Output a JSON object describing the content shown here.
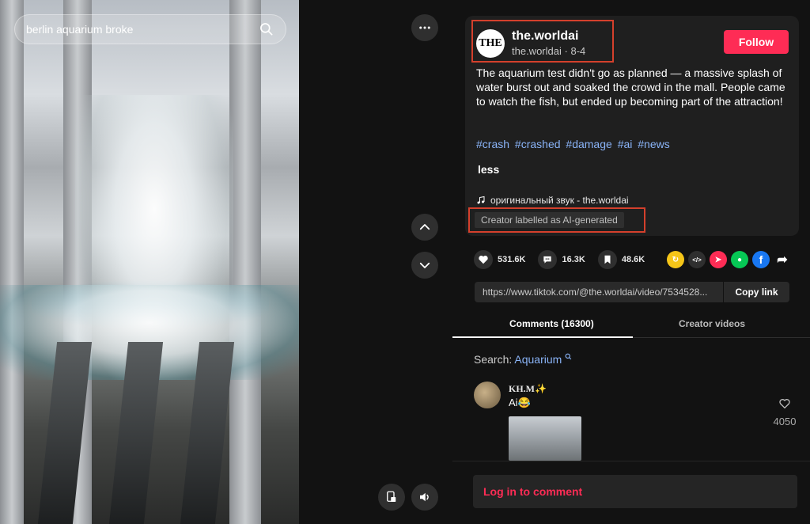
{
  "search": {
    "value": "berlin aquarium broke"
  },
  "post": {
    "username": "the.worldai",
    "handle": "the.worldai",
    "separator": "·",
    "date": "8-4",
    "avatar_text": "THE",
    "follow_label": "Follow",
    "description": "The aquarium test didn't go as planned — a massive splash of water burst out and soaked the crowd in the mall. People came to watch the fish, but ended up becoming part of the attraction!",
    "hashtags": [
      "#crash",
      "#crashed",
      "#damage",
      "#ai",
      "#news"
    ],
    "less_label": "less",
    "sound": "оригинальный звук - the.worldai",
    "ai_label": "Creator labelled as AI-generated"
  },
  "stats": {
    "likes": "531.6K",
    "comments": "16.3K",
    "saves": "48.6K"
  },
  "share_icons": [
    {
      "name": "repost-icon",
      "color": "#f5c518",
      "glyph": "↻"
    },
    {
      "name": "embed-icon",
      "color": "#2f2f2f",
      "glyph": "</>"
    },
    {
      "name": "send-icon",
      "color": "#fe2c55",
      "glyph": "➤"
    },
    {
      "name": "line-icon",
      "color": "#06c755",
      "glyph": "●"
    },
    {
      "name": "facebook-icon",
      "color": "#1877f2",
      "glyph": "f"
    },
    {
      "name": "share-arrow-icon",
      "color": "transparent",
      "glyph": "➦"
    }
  ],
  "link": {
    "url": "https://www.tiktok.com/@the.worldai/video/7534528...",
    "copy_label": "Copy link"
  },
  "tabs": {
    "comments": "Comments (16300)",
    "creator_videos": "Creator videos"
  },
  "comment_search": {
    "label": "Search:",
    "term": "Aquarium"
  },
  "comment": {
    "author": "KH.M✨",
    "text": "Ai😂",
    "likes": "4050"
  },
  "login_label": "Log in to comment",
  "colors": {
    "accent": "#fe2c55",
    "highlight_box": "#d4402c",
    "hashtag": "#8ab4f8",
    "background": "#121212"
  }
}
